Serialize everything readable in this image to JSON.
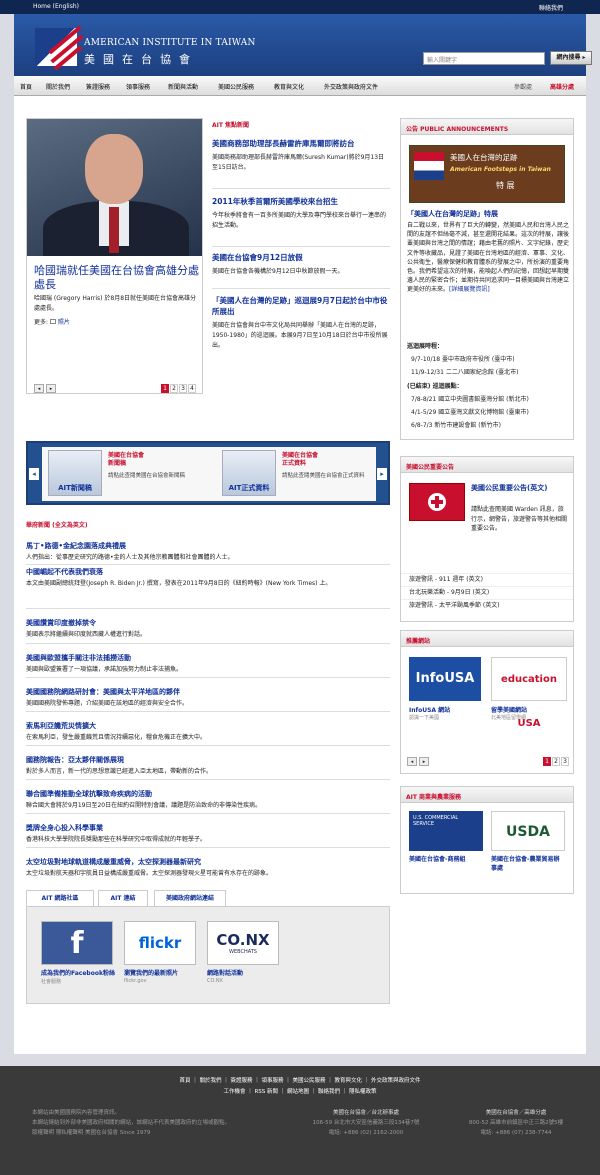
{
  "topbar": {
    "left": "Home (English)",
    "right": "聯絡我們"
  },
  "header": {
    "brand_en": "AMERICAN INSTITUTE IN TAIWAN",
    "brand_zh": "美國在台協會",
    "search_placeholder": "輸入關鍵字",
    "search_button": "網內搜尋 ▸"
  },
  "nav": {
    "items": [
      "首頁",
      "關於我們",
      "簽證服務",
      "領事服務",
      "新聞與活動",
      "美國公民服務",
      "教育與文化",
      "外交政策與政府文件"
    ],
    "right1": "參觀處",
    "right2": "高雄分處"
  },
  "feature": {
    "title": "哈國瑞就任美國在台協會高雄分處處長",
    "desc": "哈國瑞 (Gregory Harris) 於8月8日就任美國在台協會高雄分處處長。",
    "more_label": "更多:",
    "more_link": "照片",
    "pages": [
      "1",
      "2",
      "3",
      "4"
    ]
  },
  "headlines": {
    "label": "AIT 焦點新聞",
    "items": [
      {
        "title": "美國商務部助理部長赫雷許庫馬爾即將訪台",
        "desc": "美國商務部助理部長赫雷許庫馬爾(Suresh Kumar)將於9月13日至15日訪台。"
      },
      {
        "title": "2011年秋季首爾所美國學校來台招生",
        "desc": "今年秋季將會有一百多所美國的大學及專門學校來台舉行一連串的招生活動。"
      },
      {
        "title": "美國在台協會9月12日放假",
        "desc": "美國在台協會各機構於9月12日中秋節放假一天。"
      },
      {
        "title": "「美國人在台灣的足跡」巡迴展9月7日起於台中市役所展出",
        "desc": "美國在台協會與台中市文化局共同舉辦「美國人在台灣的足跡，1950-1980」的巡迴展。本展9月7日至10月18日於台中市役所展出。"
      }
    ]
  },
  "carousel": {
    "items": [
      {
        "cap": "AIT新聞稿",
        "title": "美國在台協會\n新聞稿",
        "desc": "請點此查閱美國在台協會新聞稿"
      },
      {
        "cap": "AIT正式資料",
        "title": "美國在台協會\n正式資料",
        "desc": "請點此查閱美國在台協會正式資料"
      }
    ],
    "prev": "◂",
    "next": "▸"
  },
  "announcements": {
    "label": "華府新聞 (全文為英文)",
    "items": [
      {
        "title": "馬丁•路德•金紀念園落成典禮展",
        "desc": "人們指出：從事歷史研究的路德•金的人士及其他宗教團體和社會團體的人士。"
      },
      {
        "title": "中國崛起不代表我們衰落",
        "desc": "本文由美國副總統拜登(Joseph R. Biden Jr.) 撰寫，發表在2011年9月8日的《紐約時報》(New York Times) 上。"
      },
      {
        "title": "美國讚賞印度撤掉禁令",
        "desc": "美國表示將繼續與印度就西藏人權進行對話。"
      },
      {
        "title": "美國與歐盟攜手關注非法捕撈活動",
        "desc": "美國與歐盟簽署了一項協議，承諾加強努力制止非法捕魚。"
      },
      {
        "title": "美國國務院網路研討會：美國與太平洋地區的夥伴",
        "desc": "美國國務院發佈專題，介紹美國在該地區的經濟與安全合作。"
      },
      {
        "title": "索馬利亞饑荒災情擴大",
        "desc": "在索馬利亞，發生嚴重饑荒且情況持續惡化，糧食危機正在擴大中。"
      },
      {
        "title": "國務院報告：亞太夥伴關係展現",
        "desc": "對於多人而言，新一代的思想意識已經進入亞太地區，帶動新的合作。"
      },
      {
        "title": "聯合國準備推動全球抗擊致命疾病的活動",
        "desc": "聯合國大會將於9月19日至20日在紐約召開特別會議，議題是防治致命的非傳染性疾病。"
      },
      {
        "title": "獎牌全身心投入科學事業",
        "desc": "香港科技大學學院院長獎勵那些在科學研究中取得成就的年輕學子。"
      },
      {
        "title": "太空垃圾對地球軌道構成嚴重威脅，太空探測器最新研究",
        "desc": "太空垃圾對航天器和宇航員日益構成嚴重威脅。太空探測器發現火星可能曾有水存在的跡象。"
      }
    ]
  },
  "social": {
    "tabs": [
      "AIT 網路社區",
      "AIT 連結",
      "美國政府網站連結"
    ],
    "items": [
      {
        "icon": "facebook-logo",
        "name": "成為我們的Facebook粉絲",
        "sub": "社會服務"
      },
      {
        "icon": "flickr-logo",
        "name": "瀏覽我們的最新照片",
        "sub": "flickr.gov"
      },
      {
        "icon": "conx-logo",
        "name": "網路對話活動",
        "sub": "CO.NX"
      }
    ],
    "flickr_text": "flickr",
    "conx_text": "CO.NX",
    "conx_sub": "WEBCHATS"
  },
  "right": {
    "public": {
      "label": "公告 PUBLIC ANNOUNCEMENTS",
      "banner_line1": "美國人在台灣的足跡",
      "banner_line2": "American Footsteps in Taiwan",
      "banner_line3": "特 展",
      "title": "「美國人在台灣的足跡」特展",
      "desc": "自二戰以來，世界有了巨大的轉變，然美國人民和台灣人民之間的友誼不但絲毫不減，甚至還開花結果。這次的特展，讓後輩美國與台灣之間的情誼；藉由老舊的照片、文字紀錄，歷史文件等收藏品，見證了美國在台灣地區的經濟、軍事、文化、公共衛生，醫療保健和教育體系的發展之中，所扮演的重要角色。我們希望這次的特展，能喚起人們的記憶，回想起早期雙邊人民的緊密合作；並期待共同追求同一目標美國與台灣建立更美好的未來。",
      "more": "[詳細展覽資訊]",
      "tour_label": "巡迴展時程：",
      "tour": [
        "9/7-10/18 臺中市政府市役所 (臺中市)",
        "11/9-12/31 二二八國家紀念館 (臺北市)"
      ],
      "done_label": "(已結束) 巡迴展點：",
      "done": [
        "7/8-8/21 國立中央圖書館臺灣分館 (新北市)",
        "4/1-5/29 國立臺灣文獻文化博物館 (臺東市)",
        "6/8-7/3 新竹市建設會館 (新竹市)"
      ]
    },
    "citizen": {
      "label": "美國公民重要公告",
      "title": "美國公民重要公告(英文)",
      "desc": "請點此查閱美國 Warden 訊息，旅行示，網警告，旅遊警告等其他相關重要公告。",
      "links": [
        "旅遊警訊 - 911 週年 (英文)",
        "台北玩樂活動 - 9月9日 (英文)",
        "旅遊警訊 - 太平洋颱風季節 (英文)"
      ]
    },
    "recommended": {
      "label": "推薦網站",
      "items": [
        {
          "logo": "InfoUSA",
          "name": "InfoUSA 網站",
          "sub": "認識一下美國"
        },
        {
          "logo": "education USA",
          "name": "留學美國網站",
          "sub": "北美地區留學網"
        }
      ],
      "pages": [
        "1",
        "2",
        "3"
      ]
    },
    "commercial": {
      "label": "AIT 商業與農業服務",
      "items": [
        {
          "logo": "U.S. COMMERCIAL SERVICE",
          "name": "美國在台協會-商務組"
        },
        {
          "logo": "USDA",
          "name": "美國在台協會-農業貿易辦事處"
        }
      ]
    }
  },
  "footer": {
    "links1": "首頁 ｜ 關於我們 ｜ 簽證服務 ｜ 領事服務 ｜ 美國公民服務 ｜ 教育與文化 ｜ 外交政策與政府文件",
    "links2": "工作機會 ｜ RSS 新聞 ｜ 網站地圖 ｜ 聯絡我們 ｜ 隱私權政策",
    "col1": "本網站由美國國務院內容管理資訊。\n本網站鏈結到外部非美國政府相關的網站，該網站不代表美國政府的立場或觀點。\n版權聲明 隱私權聲明 美國在台協會 Since 1979",
    "col2_head": "美國在台協會／台北辦事處",
    "col2": "106-59 台北市大安區信義路三段134巷7號\n電話: +886 (02) 2162-2000",
    "col3_head": "美國在台協會／高雄分處",
    "col3": "800-52 高雄市前鎮區中正三路2號5樓\n電話: +886 (07) 238-7744"
  },
  "colors": {
    "navy": "#0f2650",
    "blue": "#1d3f7f",
    "link": "#12329a",
    "red": "#c8102e"
  }
}
